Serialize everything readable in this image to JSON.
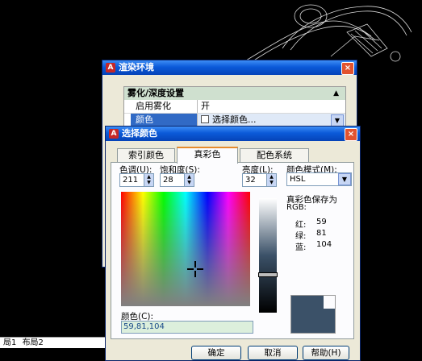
{
  "cad": {
    "layout_tabs": [
      "局1",
      "布局2"
    ]
  },
  "render_env": {
    "title": "渲染环境",
    "section": "雾化/深度设置",
    "rows": [
      {
        "name": "启用雾化",
        "value": "开"
      },
      {
        "name": "颜色",
        "value": "选择颜色..."
      }
    ]
  },
  "color_dialog": {
    "title": "选择颜色",
    "tabs": [
      "索引颜色",
      "真彩色",
      "配色系统"
    ],
    "active_tab": "真彩色",
    "hue_label": "色调(U):",
    "hue": "211",
    "sat_label": "饱和度(S):",
    "sat": "28",
    "lum_label": "亮度(L):",
    "lum": "32",
    "model_label": "颜色模式(M):",
    "model": "HSL",
    "saved_as": "真彩色保存为",
    "rgb_label": "RGB:",
    "red_label": "红:",
    "red": "59",
    "green_label": "绿:",
    "green": "81",
    "blue_label": "蓝:",
    "blue": "104",
    "color_label": "颜色(C):",
    "color_value": "59,81,104",
    "preview_color": "#3b5168",
    "buttons": {
      "ok": "确定",
      "cancel": "取消",
      "help": "帮助(H)"
    }
  }
}
